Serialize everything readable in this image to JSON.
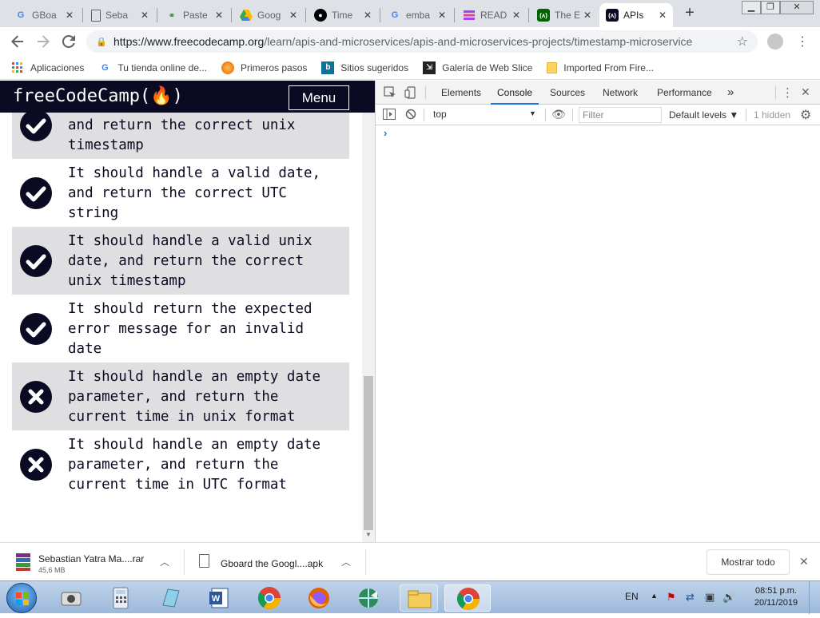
{
  "browser": {
    "tabs": [
      {
        "label": "GBoa",
        "icon": "google-icon",
        "color": "#4285f4"
      },
      {
        "label": "Seba",
        "icon": "document-icon",
        "color": "#5f6368"
      },
      {
        "label": "Paste",
        "icon": "link-icon",
        "color": "#2e7d32"
      },
      {
        "label": "Goog",
        "icon": "google-drive-icon",
        "color": "#fbbc04"
      },
      {
        "label": "Time",
        "icon": "github-icon",
        "color": "#000000"
      },
      {
        "label": "emba",
        "icon": "google-icon",
        "color": "#4285f4"
      },
      {
        "label": "READ",
        "icon": "stack-icon",
        "color": "#a142f4"
      },
      {
        "label": "The E",
        "icon": "fcc-icon",
        "color": "#006400"
      },
      {
        "label": "APIs",
        "icon": "fcc-icon",
        "color": "#0a0a23",
        "active": true
      }
    ],
    "new_tab_glyph": "+",
    "url_host": "https://www.freecodecamp.org",
    "url_path": "/learn/apis-and-microservices/apis-and-microservices-projects/timestamp-microservice",
    "bookmarks": [
      {
        "label": "Aplicaciones",
        "icon": "apps-grid-icon"
      },
      {
        "label": "Tu tienda online de...",
        "icon": "google-icon"
      },
      {
        "label": "Primeros pasos",
        "icon": "firefox-icon"
      },
      {
        "label": "Sitios sugeridos",
        "icon": "bing-icon"
      },
      {
        "label": "Galería de Web Slice",
        "icon": "web-slice-icon"
      },
      {
        "label": "Imported From Fire...",
        "icon": "folder-icon"
      }
    ]
  },
  "fcc": {
    "logo": "freeCodeCamp(🔥)",
    "menu_label": "Menu",
    "tests": [
      {
        "text": "It should handle a valid date, and return the correct unix timestamp",
        "passed": true,
        "shaded": true
      },
      {
        "text": "It should handle a valid date, and return the correct UTC string",
        "passed": true,
        "shaded": false
      },
      {
        "text": "It should handle a valid unix date, and return the correct unix timestamp",
        "passed": true,
        "shaded": true
      },
      {
        "text": "It should return the expected error message for an invalid date",
        "passed": true,
        "shaded": false
      },
      {
        "text": "It should handle an empty date parameter, and return the current time in unix format",
        "passed": false,
        "shaded": true
      },
      {
        "text": "It should handle an empty date parameter, and return the current time in UTC format",
        "passed": false,
        "shaded": false
      }
    ]
  },
  "devtools": {
    "tabs": [
      "Elements",
      "Console",
      "Sources",
      "Network",
      "Performance"
    ],
    "active_tab": "Console",
    "more_tabs_glyph": "»",
    "context": "top",
    "filter_placeholder": "Filter",
    "levels": "Default levels ▼",
    "hidden": "1 hidden",
    "prompt": "›"
  },
  "downloads": {
    "items": [
      {
        "name": "Sebastian Yatra Ma....rar",
        "size": "45,6 MB"
      },
      {
        "name": "Gboard the Googl....apk",
        "size": ""
      }
    ],
    "show_all": "Mostrar todo"
  },
  "taskbar": {
    "lang": "EN",
    "time": "08:51 p.m.",
    "date": "20/11/2019"
  },
  "colors": {
    "fcc_dark": "#0a0a23",
    "devtools_accent": "#1a73e8",
    "pass_fail_shade": "#dfdfe2"
  }
}
